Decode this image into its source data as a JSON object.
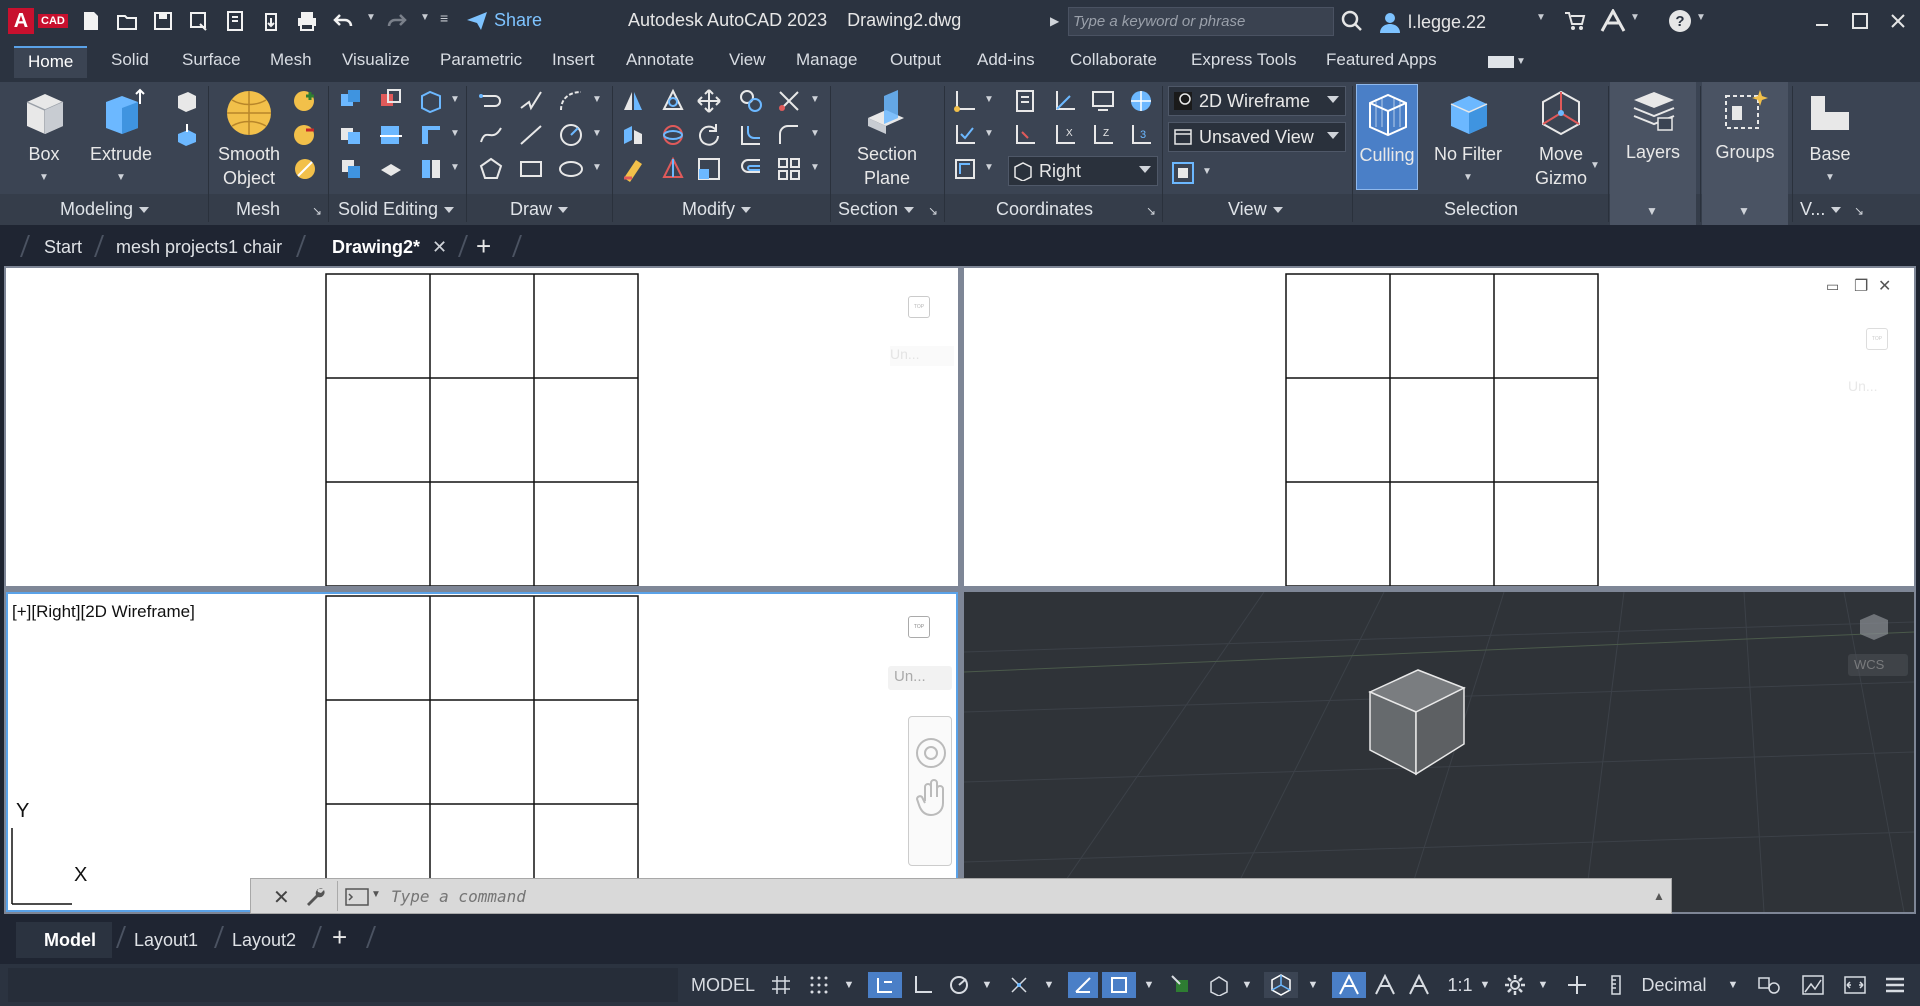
{
  "app": {
    "badge": "A",
    "badge_sub": "CAD",
    "title": "Autodesk AutoCAD 2023",
    "document": "Drawing2.dwg",
    "share_label": "Share",
    "search_placeholder": "Type a keyword or phrase",
    "user": "l.legge.22"
  },
  "ribbon_tabs": [
    "Home",
    "Solid",
    "Surface",
    "Mesh",
    "Visualize",
    "Parametric",
    "Insert",
    "Annotate",
    "View",
    "Manage",
    "Output",
    "Add-ins",
    "Collaborate",
    "Express Tools",
    "Featured Apps"
  ],
  "panels": {
    "modeling": {
      "title": "Modeling",
      "box": "Box",
      "extrude": "Extrude"
    },
    "mesh": {
      "title": "Mesh",
      "smooth": [
        "Smooth",
        "Object"
      ]
    },
    "solid_editing": {
      "title": "Solid Editing"
    },
    "draw": {
      "title": "Draw"
    },
    "modify": {
      "title": "Modify"
    },
    "section": {
      "title": "Section",
      "plane": [
        "Section",
        "Plane"
      ]
    },
    "coordinates": {
      "title": "Coordinates",
      "ucs_view": "Right"
    },
    "view": {
      "title": "View",
      "visual_style": "2D Wireframe",
      "named_view": "Unsaved View"
    },
    "selection": {
      "title": "Selection",
      "culling": "Culling",
      "nofilter": "No Filter",
      "gizmo": [
        "Move",
        "Gizmo"
      ]
    },
    "layers": {
      "label": "Layers"
    },
    "groups": {
      "label": "Groups"
    },
    "base": {
      "label": "Base",
      "title": "V..."
    }
  },
  "file_tabs": {
    "start": "Start",
    "tab1": "mesh projects1 chair",
    "tab2": "Drawing2*"
  },
  "viewport": {
    "label": "[+][Right][2D Wireframe]",
    "viewcube_face": "TOP",
    "ucs_menu": "Un...",
    "ucs_y": "Y",
    "ucs_x": "X",
    "wcs": "WCS"
  },
  "command": {
    "placeholder": "Type a command"
  },
  "layout_tabs": {
    "model": "Model",
    "layout1": "Layout1",
    "layout2": "Layout2"
  },
  "status": {
    "model": "MODEL",
    "scale": "1:1",
    "units": "Decimal"
  },
  "colors": {
    "accent": "#4a7fc7",
    "titlebar": "#2b3340",
    "ribbon": "#3b4453",
    "brand_red": "#c8102e"
  }
}
